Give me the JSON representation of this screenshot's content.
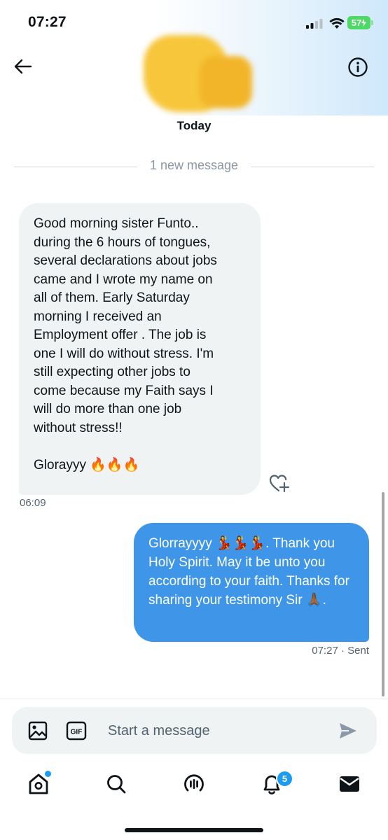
{
  "status_bar": {
    "time": "07:27",
    "battery": "57"
  },
  "header": {
    "back_icon": "arrow-left-icon",
    "info_icon": "info-circle-icon",
    "date_separator": "Today"
  },
  "divider": {
    "new_messages": "1 new message"
  },
  "messages": [
    {
      "direction": "received",
      "text": "Good morning sister Funto..\nduring the 6 hours of tongues,\nseveral declarations about jobs\ncame and I wrote my name on\nall of them. Early Saturday\nmorning I received an\nEmployment offer . The job is\none I will do without stress. I'm\nstill expecting other jobs to\ncome because my Faith says I\nwill do more than one job\nwithout stress!!\n\nGlorayyy 🔥🔥🔥",
      "time": "06:09",
      "reaction_icon": "heart-plus-icon"
    },
    {
      "direction": "sent",
      "text_before": "Glorrayyyy ",
      "emoji_dancers": "💃💃💃",
      "text_middle": ". Thank you Holy Spirit. May it be unto you according to your faith. Thanks for sharing your testimony Sir ",
      "emoji_pray": "🙏🏾",
      "text_after": ".",
      "time": "07:27",
      "status": "· Sent"
    }
  ],
  "composer": {
    "placeholder": "Start a message",
    "image_icon": "image-icon",
    "gif_label": "GIF",
    "send_icon": "send-icon"
  },
  "nav": {
    "items": [
      "home-icon",
      "search-icon",
      "spaces-icon",
      "notifications-icon",
      "messages-icon"
    ],
    "notifications_badge": "5"
  },
  "colors": {
    "accent": "#1d9bf0",
    "sent_bubble": "#3f96e8",
    "received_bubble": "#eff3f4"
  }
}
